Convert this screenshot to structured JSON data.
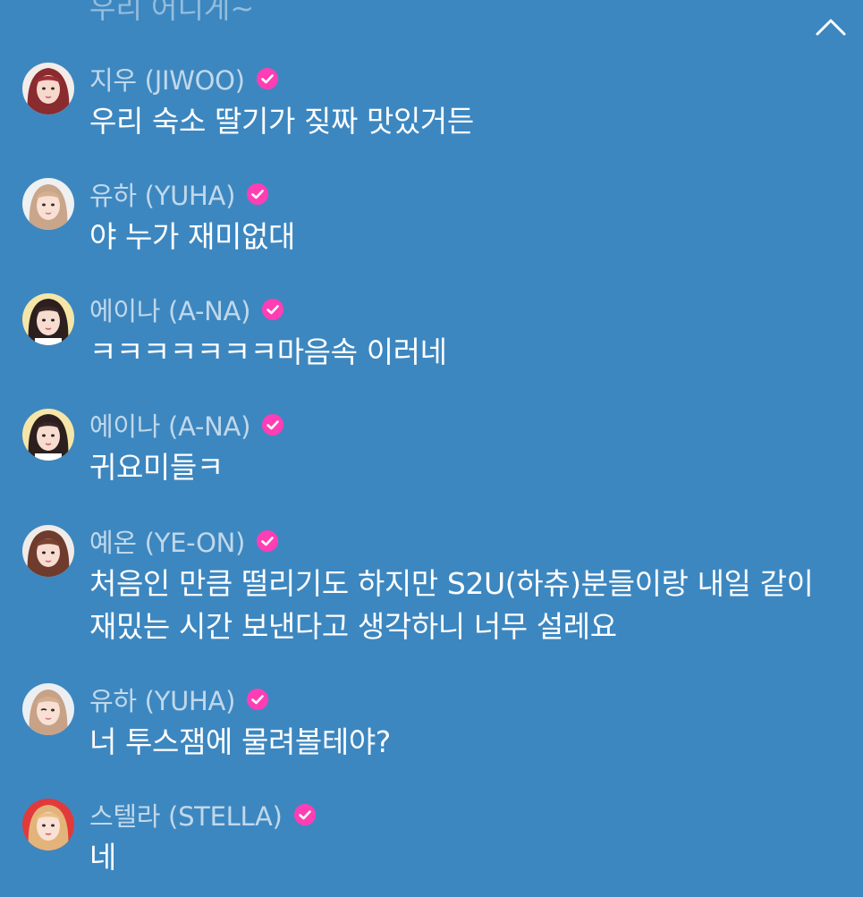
{
  "previous_message_fragment": "우리 어디게~",
  "verified_icon": "verified-check-icon",
  "colors": {
    "background": "#3d87c0",
    "verified_badge": "#ff3eb5",
    "name_text": "rgba(255,255,255,0.68)",
    "message_text": "#ffffff"
  },
  "messages": [
    {
      "name": "지우 (JIWOO)",
      "text": "우리 숙소 딸기가 짖짜 맛있거든"
    },
    {
      "name": "유하 (YUHA)",
      "text": "야 누가 재미없대"
    },
    {
      "name": "에이나 (A-NA)",
      "text": "ㅋㅋㅋㅋㅋㅋㅋ마음속 이러네"
    },
    {
      "name": "에이나 (A-NA)",
      "text": "귀요미들ㅋ"
    },
    {
      "name": "예온 (YE-ON)",
      "text": "처음인 만큼 떨리기도 하지만 S2U(하츄)분들이랑 내일 같이 재밌는 시간 보낸다고 생각하니 너무 설레요"
    },
    {
      "name": "유하 (YUHA)",
      "text": "너 투스잼에 물려볼테야?"
    },
    {
      "name": "스텔라 (STELLA)",
      "text": "네"
    }
  ]
}
